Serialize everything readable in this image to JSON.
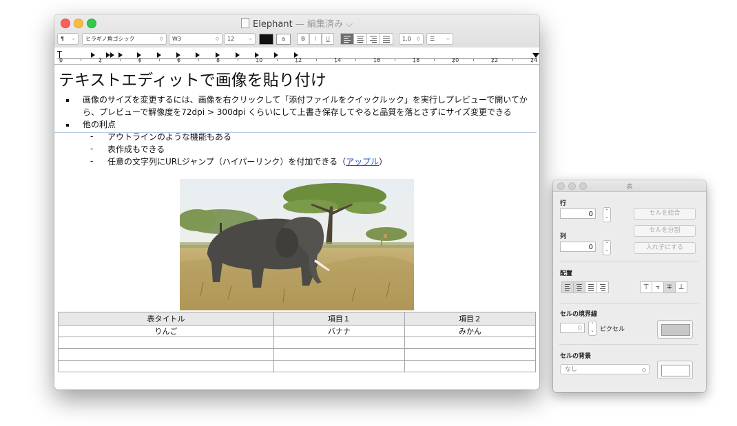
{
  "window": {
    "title": "Elephant",
    "title_suffix": "— 編集済み",
    "title_chevron": "⌵"
  },
  "toolbar": {
    "paragraph_style": "¶",
    "font_family": "ヒラギノ角ゴシック",
    "font_weight": "W3",
    "font_size": "12",
    "bold": "B",
    "italic": "I",
    "underline": "U",
    "line_spacing": "1.0",
    "list_style": "☰",
    "text_color": "#111111",
    "highlight_color": "a"
  },
  "ruler": {
    "numbers": [
      "0",
      "2",
      "4",
      "6",
      "8",
      "10",
      "12",
      "14",
      "16",
      "18",
      "20",
      "22",
      "24"
    ]
  },
  "document": {
    "heading": "テキストエディットで画像を貼り付け",
    "bullets": [
      {
        "line1": "画像のサイズを変更するには、画像を右クリックして「添付ファイルをクイックルック」を実行しプレビューで開いてか",
        "line2": "ら、プレビューで解像度を72dpi > 300dpi くらいにして上書き保存してやると品質を落とさずにサイズ変更できる"
      },
      {
        "line1": "他の利点"
      }
    ],
    "sub_items": [
      {
        "dash": "-",
        "text": "アウトラインのような機能もある"
      },
      {
        "dash": "-",
        "text": "表作成もできる"
      },
      {
        "dash": "-",
        "text_before": "任意の文字列にURLジャンプ（ハイパーリンク）を付加できる（",
        "link": "アップル",
        "text_after": "）"
      }
    ],
    "table": {
      "header": [
        "表タイトル",
        "項目１",
        "項目２"
      ],
      "rows": [
        [
          "りんご",
          "バナナ",
          "みかん"
        ],
        [
          "",
          "",
          ""
        ],
        [
          "",
          "",
          ""
        ],
        [
          "",
          "",
          ""
        ]
      ]
    }
  },
  "table_panel": {
    "title": "表",
    "rows_label": "行",
    "rows_value": "0",
    "columns_label": "列",
    "columns_value": "0",
    "merge_button": "セルを結合",
    "split_button": "セルを分割",
    "nest_button": "入れ子にする",
    "alignment_label": "配置",
    "border_label": "セルの境界線",
    "border_width": "0",
    "border_unit": "ピクセル",
    "border_color": "#c8c8c8",
    "background_label": "セルの背景",
    "background_option": "なし",
    "background_color": "#ffffff"
  }
}
